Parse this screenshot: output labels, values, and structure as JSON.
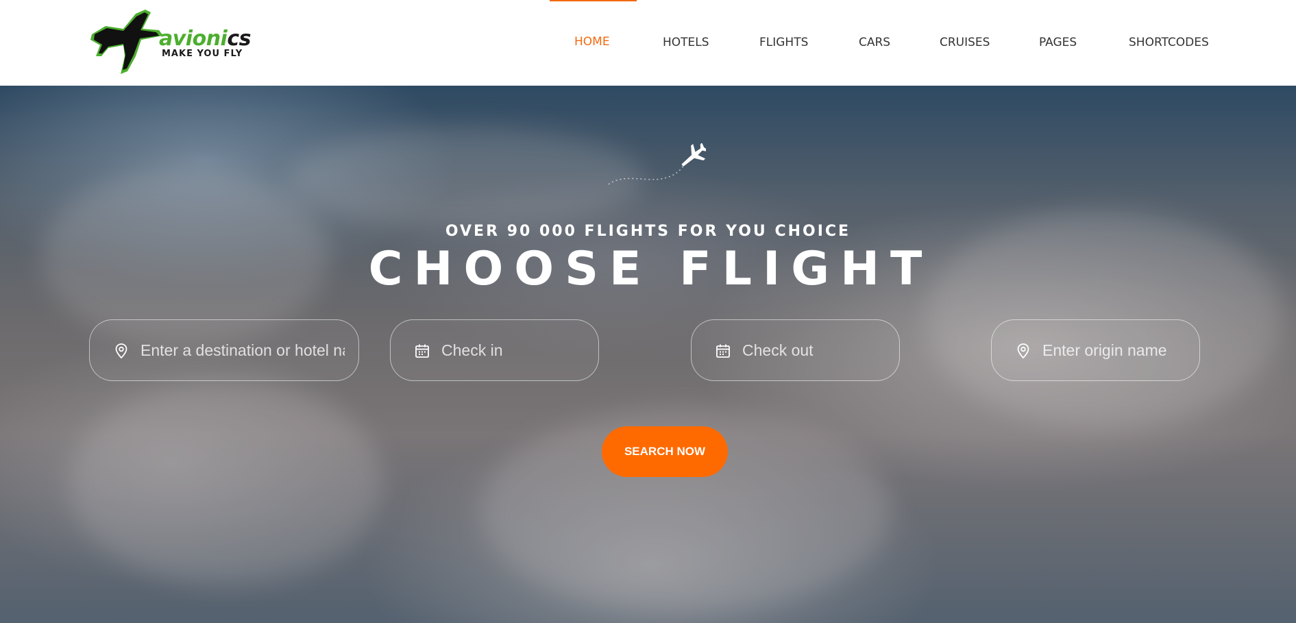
{
  "brand": {
    "name_part1": "avioni",
    "name_part2": "cs",
    "tagline": "MAKE YOU FLY"
  },
  "nav": {
    "items": [
      {
        "label": "HOME",
        "active": true
      },
      {
        "label": "HOTELS",
        "active": false
      },
      {
        "label": "FLIGHTS",
        "active": false
      },
      {
        "label": "CARS",
        "active": false
      },
      {
        "label": "CRUISES",
        "active": false
      },
      {
        "label": "PAGES",
        "active": false
      },
      {
        "label": "SHORTCODES",
        "active": false
      }
    ]
  },
  "hero": {
    "subtitle": "OVER 90 000 FLIGHTS FOR YOU CHOICE",
    "title": "CHOOSE FLIGHT"
  },
  "search": {
    "destination_placeholder": "Enter a destination or hotel name",
    "checkin_placeholder": "Check in",
    "checkout_placeholder": "Check out",
    "origin_placeholder": "Enter origin name",
    "button_label": "SEARCH NOW"
  },
  "colors": {
    "accent": "#ff6a00",
    "nav_active": "#f26a10",
    "logo_green": "#4cae2e"
  },
  "icons": {
    "destination": "map-pin-icon",
    "checkin": "calendar-icon",
    "checkout": "calendar-icon",
    "origin": "map-pin-icon",
    "hero_plane": "airplane-icon"
  }
}
